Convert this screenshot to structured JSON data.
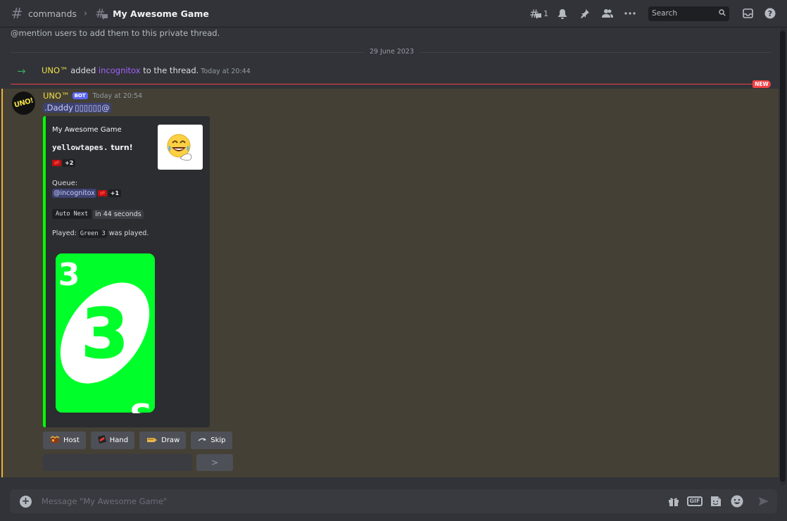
{
  "header": {
    "channel": "commands",
    "thread_title": "My Awesome Game",
    "threads_count": "1",
    "search_placeholder": "Search"
  },
  "intro_text": "@mention users to add them to this private thread.",
  "date_divider": "29 June 2023",
  "system_message": {
    "actor": "UNO™",
    "verb": " added ",
    "target": "incognitox",
    "rest": " to the thread.",
    "time": "Today at 20:44"
  },
  "new_badge": "NEW",
  "message": {
    "author": "UNO™",
    "bot_tag": "BOT",
    "time": "Today at 20:54",
    "content": ".Daddy ▯▯▯▯▯▯@",
    "avatar_text": "UNO!",
    "embed": {
      "accent_color": "#00ff00",
      "author": "My Awesome Game",
      "title_code": "yellowtapes.",
      "title_rest": " turn!",
      "draw_badge": "+2",
      "queue_label": "Queue:",
      "queue_mention": "@incognitox",
      "queue_badge": "+1",
      "auto_next": "Auto Next",
      "auto_in": "in 44 seconds",
      "played_prefix": "Played: ",
      "played_code": "Green 3",
      "played_suffix": " was played.",
      "card": {
        "color": "Green",
        "number": "3"
      }
    },
    "buttons": [
      {
        "label": "Host",
        "icon": "crown-icon"
      },
      {
        "label": "Hand",
        "icon": "cards-icon"
      },
      {
        "label": "Draw",
        "icon": "draw-icon"
      },
      {
        "label": "Skip",
        "icon": "skip-arrow-icon"
      }
    ],
    "send_glyph": ">"
  },
  "composer": {
    "placeholder": "Message \"My Awesome Game\"",
    "gif_label": "GIF"
  }
}
